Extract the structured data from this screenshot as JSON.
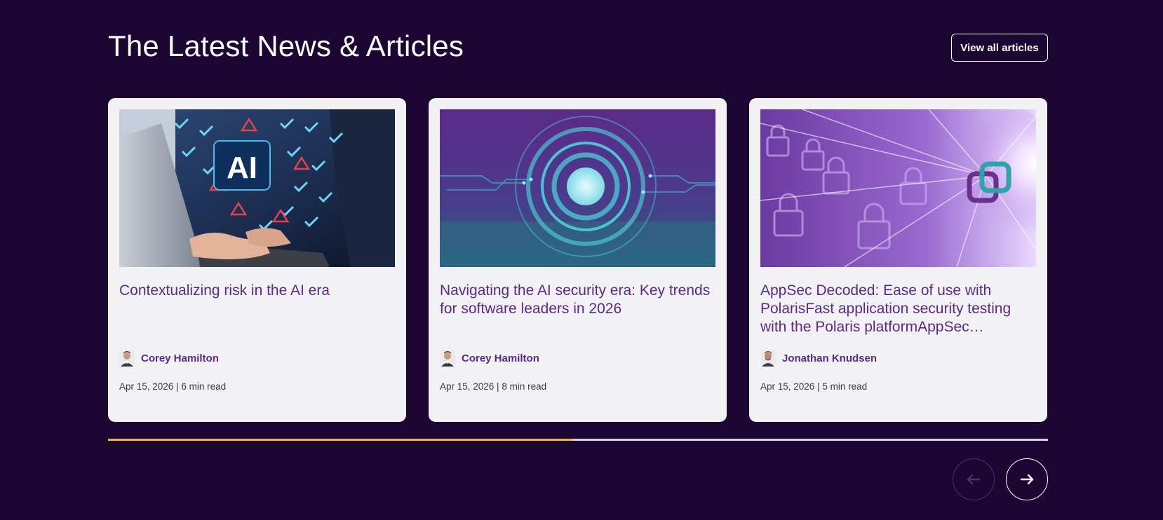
{
  "section": {
    "title": "The Latest News & Articles",
    "view_all_label": "View all articles"
  },
  "articles": [
    {
      "title": "Contextualizing risk in the AI era",
      "author": "Corey Hamilton",
      "meta": "Apr 15, 2026 | 6 min read",
      "image": "ai-laptop-checklist-image"
    },
    {
      "title": "Navigating the AI security era: Key trends for software leaders in 2026",
      "author": "Corey Hamilton",
      "meta": "Apr 15, 2026 | 8 min read",
      "image": "circuit-target-rings-image"
    },
    {
      "title": "AppSec Decoded: Ease of use with PolarisFast application security testing with the Polaris platformAppSec…",
      "author": "Jonathan Knudsen",
      "meta": "Apr 15, 2026 | 5 min read",
      "image": "padlocks-light-burst-image"
    }
  ],
  "carousel": {
    "progress": 0.494,
    "prev_icon": "arrow-left-icon",
    "next_icon": "arrow-right-icon",
    "prev_enabled": false
  },
  "colors": {
    "background": "#1c0632",
    "card": "#f2f2f5",
    "headline": "#5a2a82",
    "progress_active": "#f5b335",
    "progress_track": "#d9d0e6"
  }
}
